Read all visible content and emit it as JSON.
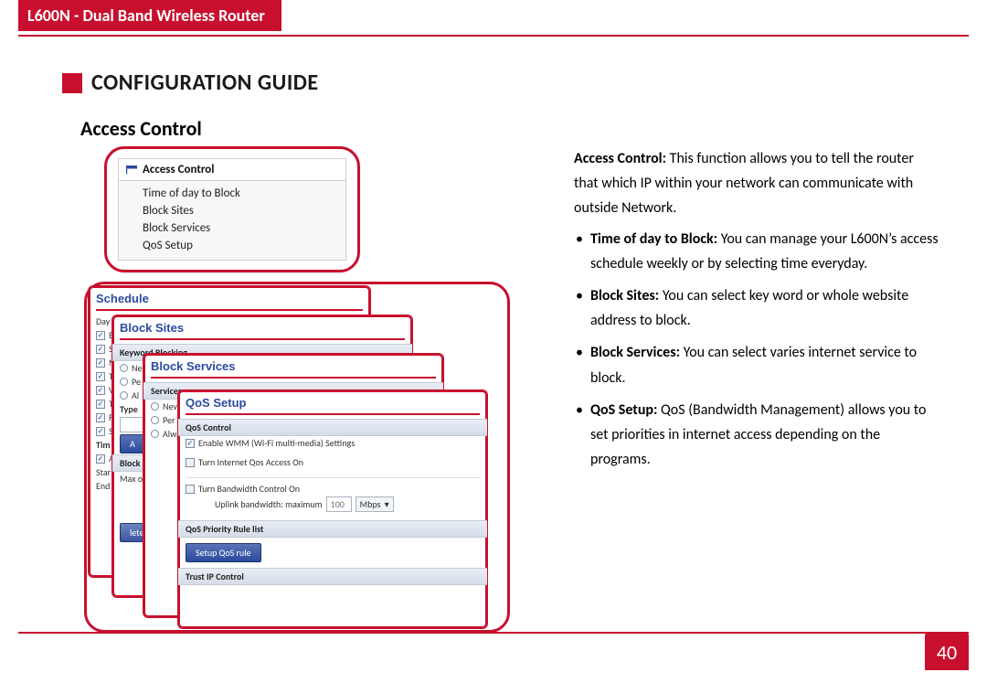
{
  "header": {
    "product": "L600N - Dual Band Wireless Router"
  },
  "guide": {
    "title": "CONFIGURATION GUIDE"
  },
  "section": {
    "title": "Access Control"
  },
  "nav": {
    "heading": "Access Control",
    "items": [
      "Time of day to Block",
      "Block Sites",
      "Block Services",
      "QoS Setup"
    ]
  },
  "panels": {
    "schedule": {
      "title": "Schedule",
      "days_label": "Day",
      "sun": "S",
      "mon": "M",
      "time_hdr": "Tim",
      "start": "Star",
      "end": "End"
    },
    "blocksites": {
      "title": "Block Sites",
      "kw_hdr": "Keyword Blocking",
      "never": "Ne",
      "per": "Pe",
      "always": "Al",
      "type": "Type",
      "add": "A",
      "blkse": "Block Se",
      "max": "Max of ru",
      "del": "lete Keyw"
    },
    "blockservices": {
      "title": "Block Services",
      "svc_hdr": "Services",
      "never": "Neve",
      "pers": "Per S",
      "alwa": "Alwa"
    },
    "qos": {
      "title": "QoS Setup",
      "ctrl_hdr": "QoS Control",
      "wmm": "Enable WMM (Wi-Fi multi-media) Settings",
      "access": "Turn Internet Qos Access On",
      "bwctrl": "Turn Bandwidth Control On",
      "uplink": "Uplink bandwidth: maximum",
      "uplink_val": "100",
      "unit": "Mbps",
      "prio_hdr": "QoS Priority Rule list",
      "btn": "Setup QoS rule",
      "trust_hdr": "Trust IP Control"
    }
  },
  "body": {
    "intro_bold": "Access Control:",
    "intro": "This function allows you to tell the router that which IP within your network can communicate with outside Network.",
    "items": [
      {
        "bold": "Time of day to Block:",
        "text": "You can manage your L600N’s access schedule weekly or by selecting time everyday."
      },
      {
        "bold": "Block Sites:",
        "text": "You can select key word or whole website address to block."
      },
      {
        "bold": "Block Services:",
        "text": "You can select varies internet service to block."
      },
      {
        "bold": "QoS Setup:",
        "text": "QoS (Bandwidth Management) allows you to set priorities in internet access depending on the programs."
      }
    ]
  },
  "page": {
    "number": "40"
  }
}
